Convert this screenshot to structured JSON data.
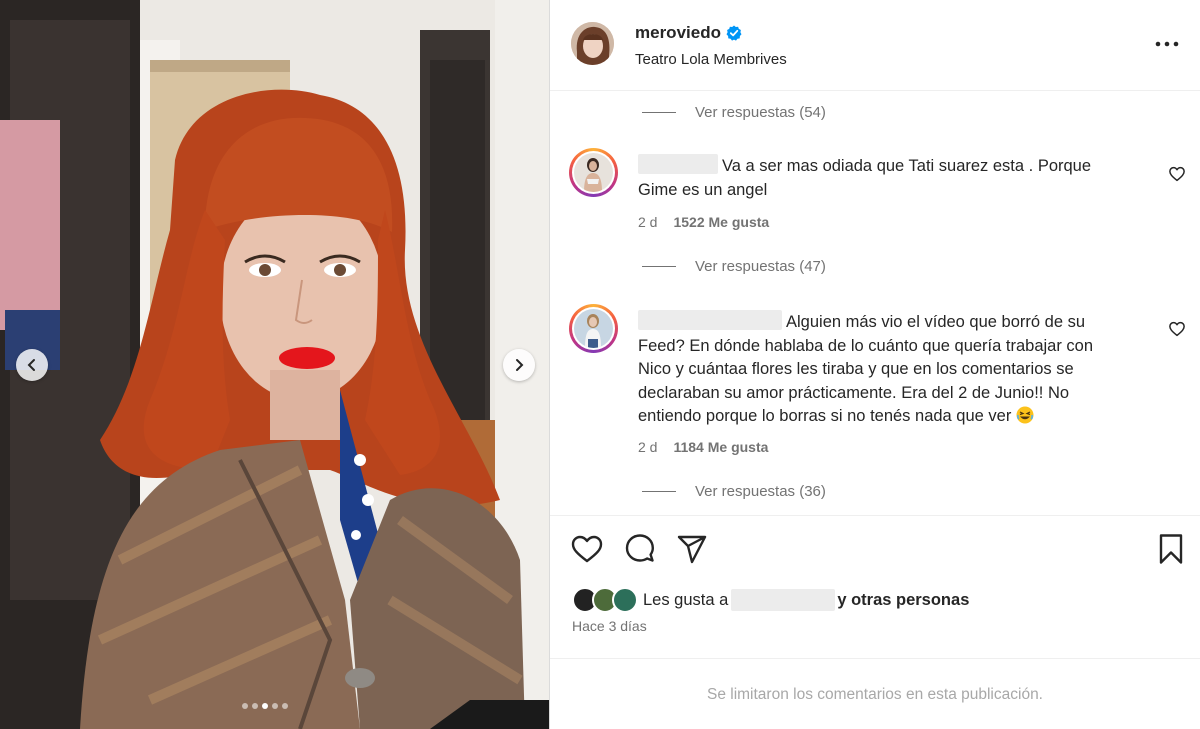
{
  "post": {
    "username": "meroviedo",
    "location": "Teatro Lola Membrives",
    "verified": true
  },
  "media": {
    "carousel_count": 5,
    "active_index": 2
  },
  "comments": {
    "replies_top": "Ver respuestas (54)",
    "items": [
      {
        "text": "Va a ser mas odiada que Tati suarez esta . Porque Gime es un angel",
        "time": "2 d",
        "likes": "1522 Me gusta",
        "replies": "Ver respuestas (47)"
      },
      {
        "text": "Alguien más vio el vídeo que borró de su Feed? En dónde hablaba de lo cuánto que quería trabajar con Nico y cuántaa flores les tiraba y que en los comentarios se declaraban su amor prácticamente. Era del 2 de Junio!! No entiendo porque lo borras si no tenés nada que ver",
        "time": "2 d",
        "likes": "1184 Me gusta",
        "replies": "Ver respuestas (36)"
      }
    ]
  },
  "likes": {
    "prefix": "Les gusta a",
    "suffix": "y otras personas"
  },
  "posted_time": "Hace 3 días",
  "comments_limited": "Se limitaron los comentarios en esta publicación.",
  "icons": {
    "heart": "heart-icon",
    "comment": "comment-icon",
    "share": "paper-plane-icon",
    "save": "bookmark-icon",
    "more": "more-options-icon",
    "verified": "verified-badge-icon"
  },
  "colors": {
    "text": "#262626",
    "secondary": "#737373",
    "verified": "#0095f6",
    "lips": "#e4161c",
    "hair": "#c0471c"
  }
}
